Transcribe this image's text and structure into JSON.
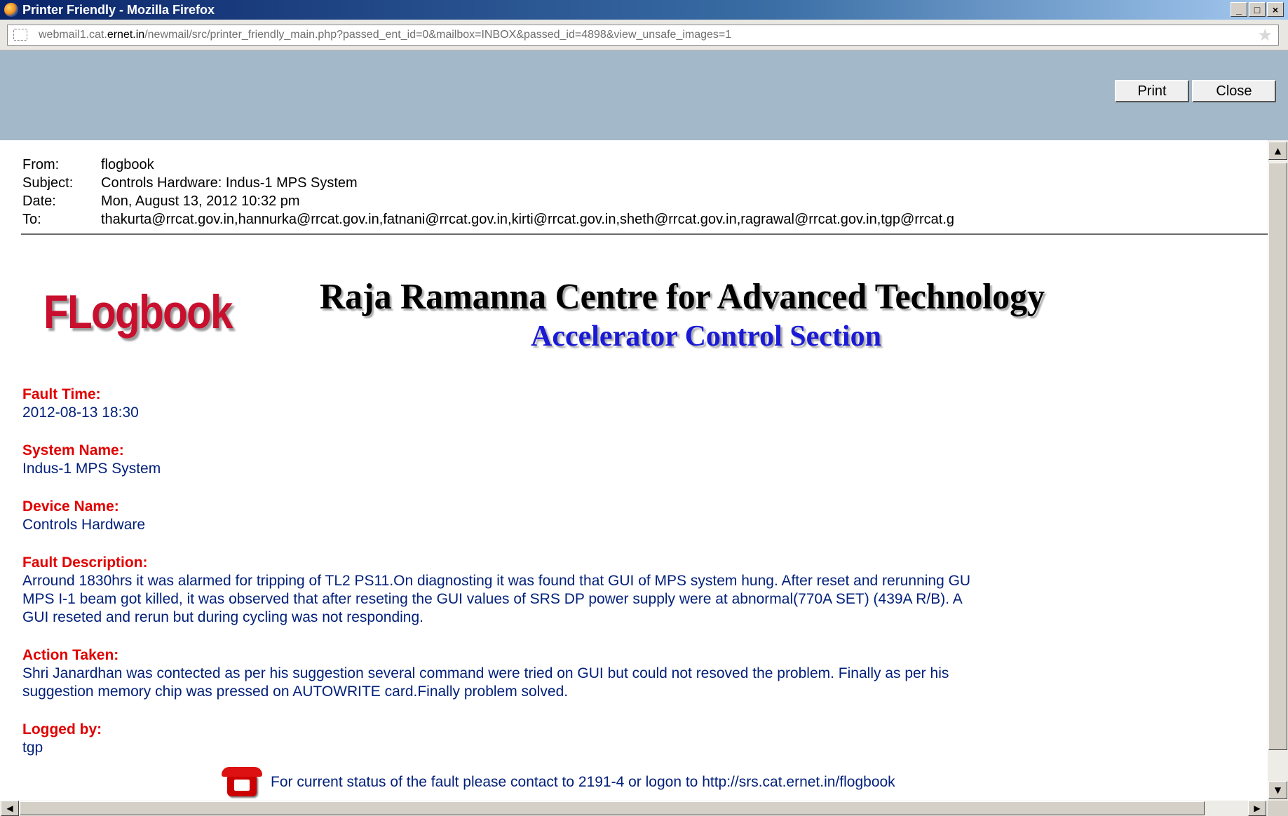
{
  "window": {
    "title": "Printer Friendly - Mozilla Firefox",
    "controls": {
      "minimize": "_",
      "maximize": "□",
      "close": "×"
    }
  },
  "address_bar": {
    "url_prefix": "webmail1.cat.",
    "url_domain": "ernet.in",
    "url_suffix": "/newmail/src/printer_friendly_main.php?passed_ent_id=0&mailbox=INBOX&passed_id=4898&view_unsafe_images=1"
  },
  "toolbar": {
    "print_label": "Print",
    "close_label": "Close"
  },
  "email_header": {
    "from_label": "From:",
    "from": "flogbook",
    "subject_label": "Subject:",
    "subject": "Controls Hardware: Indus-1 MPS System",
    "date_label": "Date:",
    "date": "Mon, August 13, 2012 10:32 pm",
    "to_label": "To:",
    "to": "thakurta@rrcat.gov.in,hannurka@rrcat.gov.in,fatnani@rrcat.gov.in,kirti@rrcat.gov.in,sheth@rrcat.gov.in,ragrawal@rrcat.gov.in,tgp@rrcat.g"
  },
  "banner": {
    "logo_text": "FLogbook",
    "organization": "Raja Ramanna Centre for Advanced Technology",
    "section": "Accelerator Control Section"
  },
  "fault": {
    "fault_time_label": "Fault Time:",
    "fault_time": "2012-08-13 18:30",
    "system_name_label": "System Name:",
    "system_name": "Indus-1 MPS System",
    "device_name_label": "Device Name:",
    "device_name": "Controls Hardware",
    "description_label": "Fault Description:",
    "description_lines": [
      "Arround 1830hrs it was alarmed for tripping of TL2 PS11.On diagnosting it was found that GUI of MPS system hung. After reset and rerunning GU",
      "MPS I-1 beam got killed, it was observed that after reseting the GUI values of SRS DP power supply were at abnormal(770A SET) (439A R/B). A",
      "GUI reseted and rerun but during cycling was not responding."
    ],
    "action_label": "Action Taken:",
    "action_lines": [
      "Shri Janardhan was contected as per his suggestion several command were tried on GUI but could not resoved the problem. Finally as per his",
      "suggestion memory chip was pressed on AUTOWRITE card.Finally problem solved."
    ],
    "logged_by_label": "Logged by:",
    "logged_by": "tgp"
  },
  "footer": {
    "contact_text": "For current status of the fault please contact to 2191-4 or logon to http://srs.cat.ernet.in/flogbook"
  },
  "icons": {
    "window_icon": "firefox-icon",
    "site_icon": "site-identity-icon",
    "bookmark_icon": "star-icon",
    "footer_icon": "telephone-icon"
  }
}
